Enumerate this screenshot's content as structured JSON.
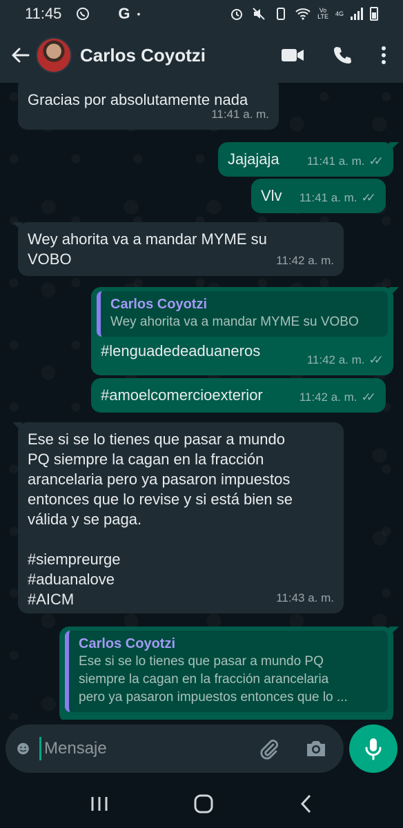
{
  "status_bar": {
    "time": "11:45",
    "network_top": "Vo",
    "network_bottom": "LTE",
    "net_type": "4G",
    "g_label": "G",
    "dot": "•"
  },
  "header": {
    "contact_name": "Carlos Coyotzi",
    "icons": [
      "back-arrow-icon",
      "video-call-icon",
      "phone-icon",
      "more-options-icon"
    ]
  },
  "messages": [
    {
      "direction": "in",
      "text": "Gracias por absolutamente nada",
      "time": "11:41 a. m."
    },
    {
      "direction": "out",
      "text": "Jajajaja",
      "time": "11:41 a. m.",
      "read": true
    },
    {
      "direction": "out",
      "text": "Vlv",
      "time": "11:41 a. m.",
      "read": true
    },
    {
      "direction": "in",
      "text": "Wey ahorita va a mandar MYME su VOBO",
      "time": "11:42 a. m."
    },
    {
      "direction": "out",
      "quote_name": "Carlos Coyotzi",
      "quote_text": "Wey ahorita va a mandar MYME su VOBO",
      "text": "#lenguadedeaduaneros",
      "time": "11:42 a. m.",
      "read": true
    },
    {
      "direction": "out",
      "text": "#amoelcomercioexterior",
      "time": "11:42 a. m.",
      "read": true
    },
    {
      "direction": "in",
      "text_lines": [
        "Ese si se lo tienes que pasar a mundo",
        "PQ siempre la cagan en la fracción",
        "arancelaria pero ya pasaron impuestos",
        "entonces que lo revise y si está bien se",
        "válida y se paga.",
        "",
        "#siempreurge",
        "#aduanalove",
        "#AICM"
      ],
      "time": "11:43 a. m."
    },
    {
      "direction": "out",
      "quote_name": "Carlos Coyotzi",
      "quote_lines": [
        "Ese si se lo tienes que pasar a mundo PQ",
        "siempre la cagan en la fracción arancelaria",
        "pero ya pasaron impuestos entonces que lo ..."
      ]
    }
  ],
  "composer": {
    "placeholder": "Mensaje",
    "icons": [
      "emoji-icon",
      "attach-icon",
      "camera-icon",
      "mic-icon"
    ]
  },
  "navbar": {
    "icons": [
      "recent-apps-icon",
      "home-icon",
      "back-icon"
    ]
  },
  "colors": {
    "background": "#0b141a",
    "bar": "#1f2c34",
    "incoming_bubble": "#1f2c34",
    "outgoing_bubble": "#005c4b",
    "accent": "#00a884",
    "quote_accent": "#a29af5"
  }
}
